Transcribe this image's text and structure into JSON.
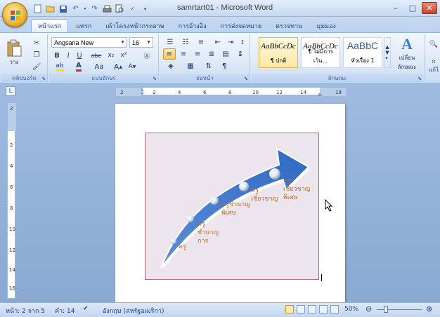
{
  "window": {
    "title": "samrtart01 - Microsoft Word",
    "controls": [
      "minimize-icon",
      "maximize-icon",
      "close-icon"
    ]
  },
  "quick_access": [
    "new-icon",
    "open-icon",
    "save-icon",
    "undo-icon",
    "redo-icon",
    "print-icon",
    "print-preview-icon",
    "spelling-icon",
    "customize-icon"
  ],
  "tabs": [
    {
      "label": "หน้าแรก",
      "active": true
    },
    {
      "label": "แทรก"
    },
    {
      "label": "เค้าโครงหน้ากระดาษ"
    },
    {
      "label": "การอ้างอิง"
    },
    {
      "label": "การส่งจดหมาย"
    },
    {
      "label": "ตรวจทาน"
    },
    {
      "label": "มุมมอง"
    }
  ],
  "ribbon": {
    "clipboard": {
      "label": "คลิปบอร์ด",
      "paste_label": "วาง"
    },
    "font": {
      "label": "แบบอักษร",
      "font_name": "Angsana New",
      "font_size": "16",
      "buttons": [
        "B",
        "I",
        "U",
        "abe",
        "x₂",
        "x²",
        "Aa",
        "A",
        "A"
      ]
    },
    "paragraph": {
      "label": "ย่อหน้า"
    },
    "styles": {
      "label": "ลักษณะ",
      "items": [
        {
          "sample": "AaBbCcDc",
          "name": "¶ ปกติ",
          "selected": true
        },
        {
          "sample": "AaBbCcDc",
          "name": "¶ ไม่มีการเว้น..."
        },
        {
          "sample": "AaBbC",
          "name": "หัวเรื่อง 1"
        }
      ],
      "change_label_1": "เปลี่ยน",
      "change_label_2": "ลักษณะ",
      "edit_label_1": "ก",
      "edit_label_2": "แก้ไ"
    }
  },
  "ruler": {
    "corner": "L",
    "h_ticks": [
      "2",
      "2",
      "4",
      "6",
      "8",
      "10",
      "12",
      "14",
      "18"
    ],
    "v_ticks": [
      "2",
      "2",
      "4",
      "6",
      "8",
      "10",
      "12",
      "14",
      "16",
      "18"
    ]
  },
  "smartart": {
    "labels": [
      "ครู",
      "ครู\nชำนาญ\nการ",
      "ครูชำนาญ\nพิเศษ",
      "ครู\nเชี่ยวชาญ",
      "ครู\nเชี่ยวชาญ\nพิเศษ"
    ]
  },
  "status": {
    "page": "หน้า: 2 จาก 5",
    "words": "คำ: 14",
    "language": "อังกฤษ (สหรัฐอเมริกา)",
    "zoom": "50%"
  }
}
